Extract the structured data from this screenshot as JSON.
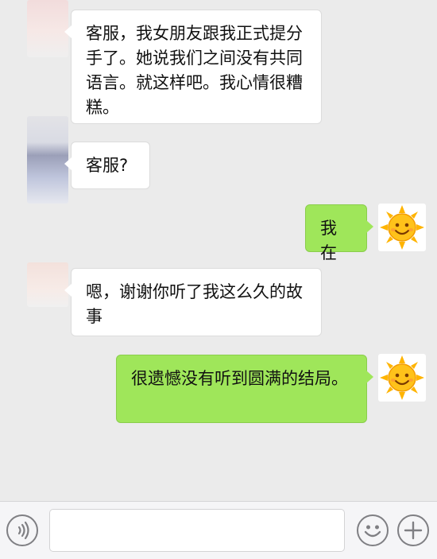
{
  "messages": [
    {
      "side": "left",
      "text": "客服，我女朋友跟我正式提分手了。她说我们之间没有共同语言。就这样吧。我心情很糟糕。"
    },
    {
      "side": "left",
      "text": "客服?"
    },
    {
      "side": "right",
      "text": "我在"
    },
    {
      "side": "left",
      "text": "嗯，谢谢你听了我这么久的故事"
    },
    {
      "side": "right",
      "text": "很遗憾没有听到圆满的结局。"
    }
  ],
  "input_bar": {
    "placeholder": "",
    "voice_icon": "voice-icon",
    "emoji_icon": "emoji-smile-icon",
    "add_icon": "plus-icon"
  },
  "colors": {
    "background": "#ebebeb",
    "bubble_left": "#ffffff",
    "bubble_right": "#9fe65a",
    "input_bar": "#f5f5f7"
  }
}
